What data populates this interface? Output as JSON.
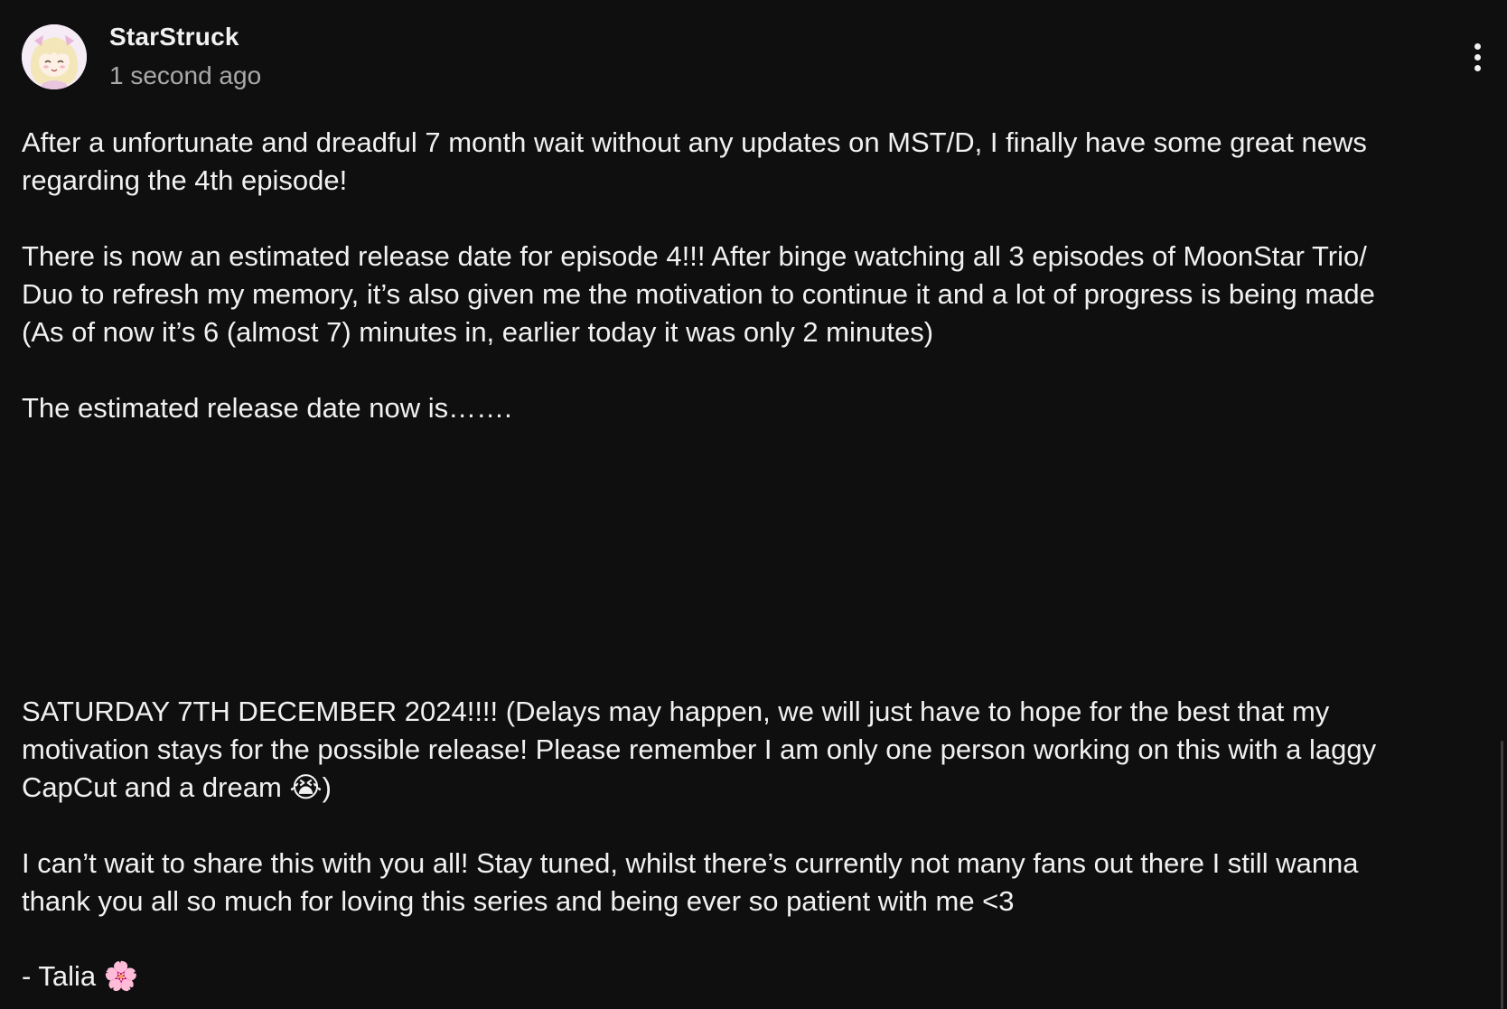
{
  "post": {
    "author": "StarStruck",
    "timestamp": "1 second ago",
    "paragraphs": [
      "After a unfortunate and dreadful 7 month wait without any updates on MST/D, I finally have some great news\nregarding the 4th episode!",
      "There is now an estimated release date for episode 4!!! After binge watching all 3 episodes of MoonStar Trio/\nDuo to refresh my memory, it’s also given me the motivation to continue it and a lot of progress is being made\n(As of now it’s 6 (almost 7) minutes in, earlier today it was only 2 minutes)",
      "The estimated release date now is…….",
      "SATURDAY 7TH DECEMBER 2024!!!! (Delays may happen, we will just have to hope for the best that my\nmotivation stays for the possible release! Please remember I am only one person working on this with a laggy\nCapCut and a dream 😭)",
      "I can’t wait to share this with you all! Stay tuned, whilst there’s currently not many fans out there I still wanna\nthank you all so much for loving this series and being ever so patient with me <3",
      "- Talia 🌸"
    ]
  },
  "icons": {
    "avatar": "anime-girl-avatar",
    "more": "more-vertical-icon"
  },
  "colors": {
    "background": "#0f0f0f",
    "text": "#f1f1f1",
    "secondary_text": "#aaaaaa"
  }
}
